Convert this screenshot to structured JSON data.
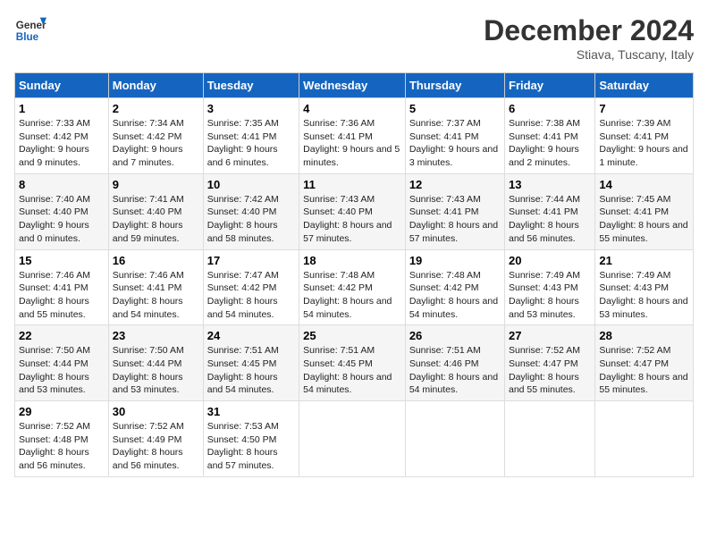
{
  "logo": {
    "line1": "General",
    "line2": "Blue"
  },
  "title": "December 2024",
  "subtitle": "Stiava, Tuscany, Italy",
  "days_of_week": [
    "Sunday",
    "Monday",
    "Tuesday",
    "Wednesday",
    "Thursday",
    "Friday",
    "Saturday"
  ],
  "weeks": [
    [
      {
        "day": "1",
        "sunrise": "Sunrise: 7:33 AM",
        "sunset": "Sunset: 4:42 PM",
        "daylight": "Daylight: 9 hours and 9 minutes."
      },
      {
        "day": "2",
        "sunrise": "Sunrise: 7:34 AM",
        "sunset": "Sunset: 4:42 PM",
        "daylight": "Daylight: 9 hours and 7 minutes."
      },
      {
        "day": "3",
        "sunrise": "Sunrise: 7:35 AM",
        "sunset": "Sunset: 4:41 PM",
        "daylight": "Daylight: 9 hours and 6 minutes."
      },
      {
        "day": "4",
        "sunrise": "Sunrise: 7:36 AM",
        "sunset": "Sunset: 4:41 PM",
        "daylight": "Daylight: 9 hours and 5 minutes."
      },
      {
        "day": "5",
        "sunrise": "Sunrise: 7:37 AM",
        "sunset": "Sunset: 4:41 PM",
        "daylight": "Daylight: 9 hours and 3 minutes."
      },
      {
        "day": "6",
        "sunrise": "Sunrise: 7:38 AM",
        "sunset": "Sunset: 4:41 PM",
        "daylight": "Daylight: 9 hours and 2 minutes."
      },
      {
        "day": "7",
        "sunrise": "Sunrise: 7:39 AM",
        "sunset": "Sunset: 4:41 PM",
        "daylight": "Daylight: 9 hours and 1 minute."
      }
    ],
    [
      {
        "day": "8",
        "sunrise": "Sunrise: 7:40 AM",
        "sunset": "Sunset: 4:40 PM",
        "daylight": "Daylight: 9 hours and 0 minutes."
      },
      {
        "day": "9",
        "sunrise": "Sunrise: 7:41 AM",
        "sunset": "Sunset: 4:40 PM",
        "daylight": "Daylight: 8 hours and 59 minutes."
      },
      {
        "day": "10",
        "sunrise": "Sunrise: 7:42 AM",
        "sunset": "Sunset: 4:40 PM",
        "daylight": "Daylight: 8 hours and 58 minutes."
      },
      {
        "day": "11",
        "sunrise": "Sunrise: 7:43 AM",
        "sunset": "Sunset: 4:40 PM",
        "daylight": "Daylight: 8 hours and 57 minutes."
      },
      {
        "day": "12",
        "sunrise": "Sunrise: 7:43 AM",
        "sunset": "Sunset: 4:41 PM",
        "daylight": "Daylight: 8 hours and 57 minutes."
      },
      {
        "day": "13",
        "sunrise": "Sunrise: 7:44 AM",
        "sunset": "Sunset: 4:41 PM",
        "daylight": "Daylight: 8 hours and 56 minutes."
      },
      {
        "day": "14",
        "sunrise": "Sunrise: 7:45 AM",
        "sunset": "Sunset: 4:41 PM",
        "daylight": "Daylight: 8 hours and 55 minutes."
      }
    ],
    [
      {
        "day": "15",
        "sunrise": "Sunrise: 7:46 AM",
        "sunset": "Sunset: 4:41 PM",
        "daylight": "Daylight: 8 hours and 55 minutes."
      },
      {
        "day": "16",
        "sunrise": "Sunrise: 7:46 AM",
        "sunset": "Sunset: 4:41 PM",
        "daylight": "Daylight: 8 hours and 54 minutes."
      },
      {
        "day": "17",
        "sunrise": "Sunrise: 7:47 AM",
        "sunset": "Sunset: 4:42 PM",
        "daylight": "Daylight: 8 hours and 54 minutes."
      },
      {
        "day": "18",
        "sunrise": "Sunrise: 7:48 AM",
        "sunset": "Sunset: 4:42 PM",
        "daylight": "Daylight: 8 hours and 54 minutes."
      },
      {
        "day": "19",
        "sunrise": "Sunrise: 7:48 AM",
        "sunset": "Sunset: 4:42 PM",
        "daylight": "Daylight: 8 hours and 54 minutes."
      },
      {
        "day": "20",
        "sunrise": "Sunrise: 7:49 AM",
        "sunset": "Sunset: 4:43 PM",
        "daylight": "Daylight: 8 hours and 53 minutes."
      },
      {
        "day": "21",
        "sunrise": "Sunrise: 7:49 AM",
        "sunset": "Sunset: 4:43 PM",
        "daylight": "Daylight: 8 hours and 53 minutes."
      }
    ],
    [
      {
        "day": "22",
        "sunrise": "Sunrise: 7:50 AM",
        "sunset": "Sunset: 4:44 PM",
        "daylight": "Daylight: 8 hours and 53 minutes."
      },
      {
        "day": "23",
        "sunrise": "Sunrise: 7:50 AM",
        "sunset": "Sunset: 4:44 PM",
        "daylight": "Daylight: 8 hours and 53 minutes."
      },
      {
        "day": "24",
        "sunrise": "Sunrise: 7:51 AM",
        "sunset": "Sunset: 4:45 PM",
        "daylight": "Daylight: 8 hours and 54 minutes."
      },
      {
        "day": "25",
        "sunrise": "Sunrise: 7:51 AM",
        "sunset": "Sunset: 4:45 PM",
        "daylight": "Daylight: 8 hours and 54 minutes."
      },
      {
        "day": "26",
        "sunrise": "Sunrise: 7:51 AM",
        "sunset": "Sunset: 4:46 PM",
        "daylight": "Daylight: 8 hours and 54 minutes."
      },
      {
        "day": "27",
        "sunrise": "Sunrise: 7:52 AM",
        "sunset": "Sunset: 4:47 PM",
        "daylight": "Daylight: 8 hours and 55 minutes."
      },
      {
        "day": "28",
        "sunrise": "Sunrise: 7:52 AM",
        "sunset": "Sunset: 4:47 PM",
        "daylight": "Daylight: 8 hours and 55 minutes."
      }
    ],
    [
      {
        "day": "29",
        "sunrise": "Sunrise: 7:52 AM",
        "sunset": "Sunset: 4:48 PM",
        "daylight": "Daylight: 8 hours and 56 minutes."
      },
      {
        "day": "30",
        "sunrise": "Sunrise: 7:52 AM",
        "sunset": "Sunset: 4:49 PM",
        "daylight": "Daylight: 8 hours and 56 minutes."
      },
      {
        "day": "31",
        "sunrise": "Sunrise: 7:53 AM",
        "sunset": "Sunset: 4:50 PM",
        "daylight": "Daylight: 8 hours and 57 minutes."
      },
      null,
      null,
      null,
      null
    ]
  ]
}
